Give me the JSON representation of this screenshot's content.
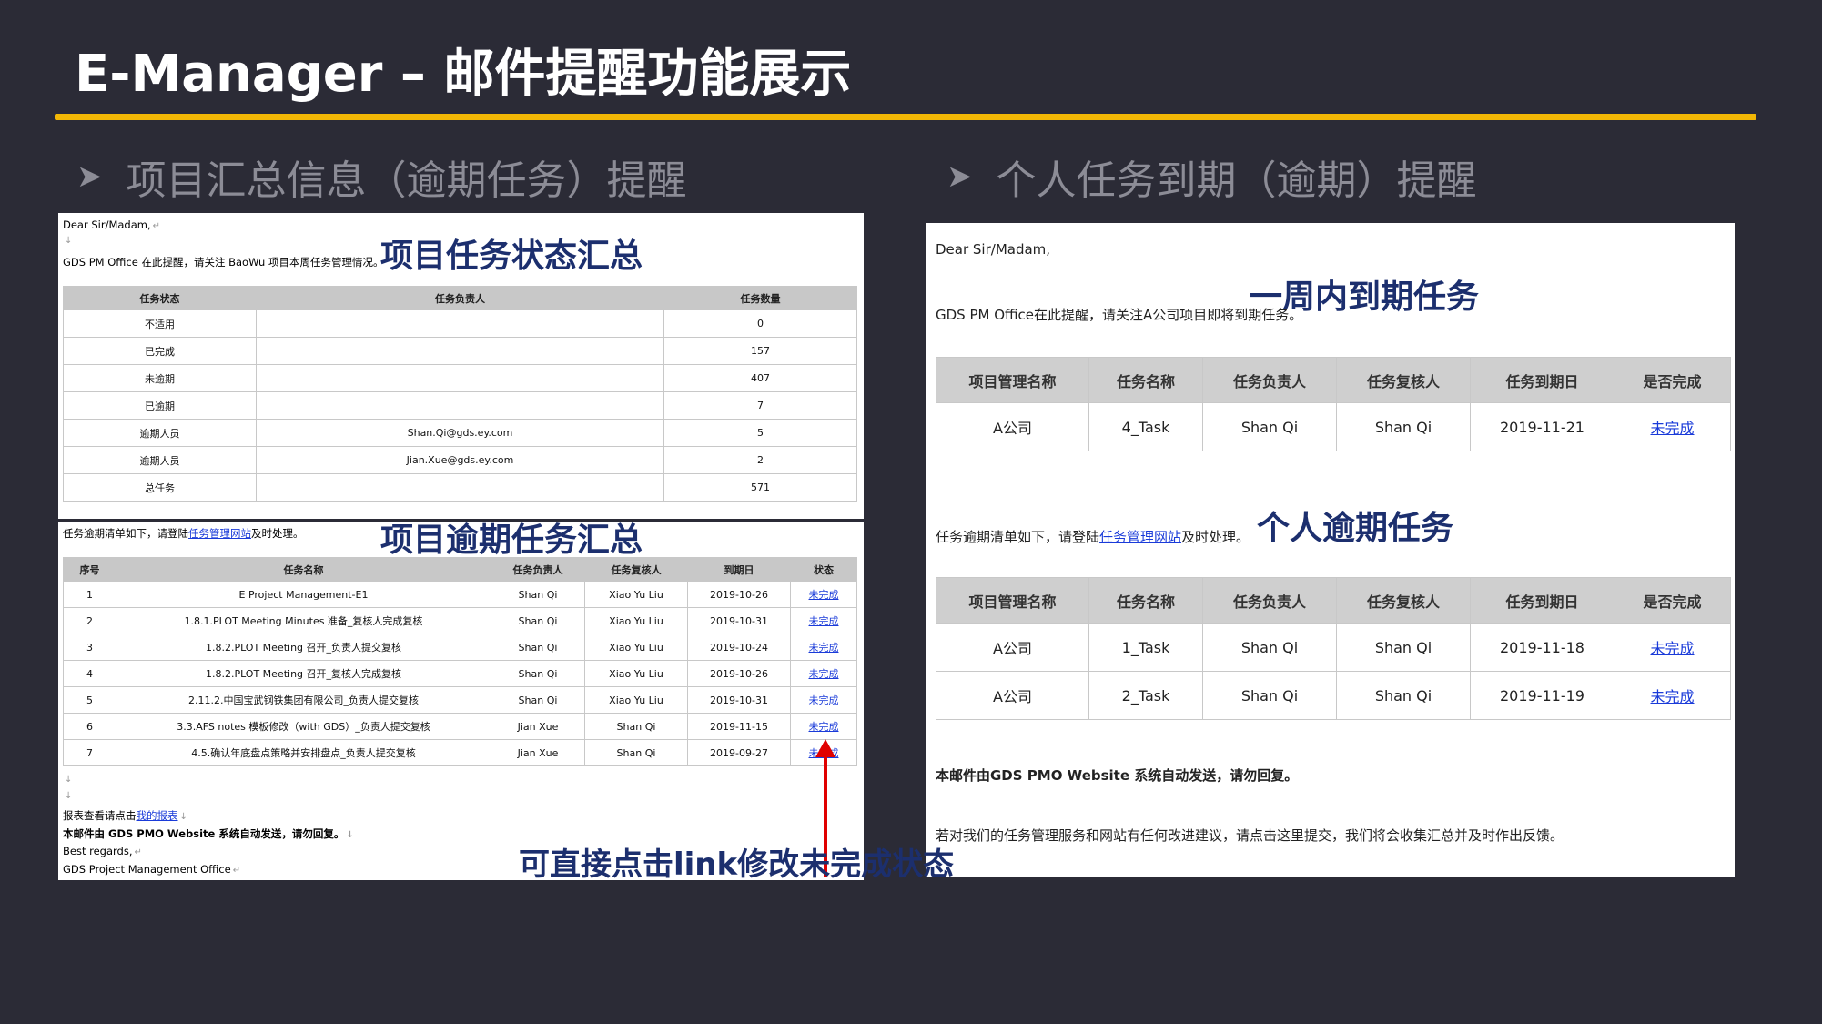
{
  "title": "E-Manager – 邮件提醒功能展示",
  "sections": {
    "left": "项目汇总信息（逾期任务）提醒",
    "right": "个人任务到期（逾期）提醒"
  },
  "icons": {
    "section_bullet": "arrowhead-bullet-icon"
  },
  "colors": {
    "background": "#2b2b36",
    "accent_rule": "#f2b705",
    "overlay_text": "#1c2f6e",
    "link": "#1a3bd9",
    "arrow": "#e00000"
  },
  "summary_mail": {
    "greeting": "Dear Sir/Madam,",
    "intro": "GDS PM Office 在此提醒，请关注 BaoWu 项目本周任务管理情况。",
    "overlay": "项目任务状态汇总",
    "headers": [
      "任务状态",
      "任务负责人",
      "任务数量"
    ],
    "rows": [
      [
        "不适用",
        "",
        "0"
      ],
      [
        "已完成",
        "",
        "157"
      ],
      [
        "未逾期",
        "",
        "407"
      ],
      [
        "已逾期",
        "",
        "7"
      ],
      [
        "逾期人员",
        "Shan.Qi@gds.ey.com",
        "5"
      ],
      [
        "逾期人员",
        "Jian.Xue@gds.ey.com",
        "2"
      ],
      [
        "总任务",
        "",
        "571"
      ]
    ]
  },
  "overdue_mail": {
    "intro_prefix": "任务逾期清单如下，请登陆",
    "intro_link": "任务管理网站",
    "intro_suffix": "及时处理。",
    "overlay": "项目逾期任务汇总",
    "headers": [
      "序号",
      "任务名称",
      "任务负责人",
      "任务复核人",
      "到期日",
      "状态"
    ],
    "rows": [
      [
        "1",
        "E Project Management-E1",
        "Shan Qi",
        "Xiao Yu Liu",
        "2019-10-26",
        "未完成"
      ],
      [
        "2",
        "1.8.1.PLOT Meeting Minutes 准备_复核人完成复核",
        "Shan Qi",
        "Xiao Yu Liu",
        "2019-10-31",
        "未完成"
      ],
      [
        "3",
        "1.8.2.PLOT Meeting 召开_负责人提交复核",
        "Shan Qi",
        "Xiao Yu Liu",
        "2019-10-24",
        "未完成"
      ],
      [
        "4",
        "1.8.2.PLOT Meeting 召开_复核人完成复核",
        "Shan Qi",
        "Xiao Yu Liu",
        "2019-10-26",
        "未完成"
      ],
      [
        "5",
        "2.11.2.中国宝武钢铁集团有限公司_负责人提交复核",
        "Shan Qi",
        "Xiao Yu Liu",
        "2019-10-31",
        "未完成"
      ],
      [
        "6",
        "3.3.AFS notes 模板修改（with GDS）_负责人提交复核",
        "Jian Xue",
        "Shan Qi",
        "2019-11-15",
        "未完成"
      ],
      [
        "7",
        "4.5.确认年底盘点策略并安排盘点_负责人提交复核",
        "Jian Xue",
        "Shan Qi",
        "2019-09-27",
        "未完成"
      ]
    ],
    "report_prefix": "报表查看请点击",
    "report_link": "我的报表",
    "auto_note": "本邮件由 GDS PMO Website 系统自动发送，请勿回复。",
    "regards": "Best regards,",
    "signature": "GDS Project Management Office"
  },
  "personal_mail": {
    "greeting": "Dear Sir/Madam,",
    "intro": "GDS PM Office在此提醒，请关注A公司项目即将到期任务。",
    "overlay_due": "一周内到期任务",
    "headers": [
      "项目管理名称",
      "任务名称",
      "任务负责人",
      "任务复核人",
      "任务到期日",
      "是否完成"
    ],
    "due_rows": [
      [
        "A公司",
        "4_Task",
        "Shan Qi",
        "Shan Qi",
        "2019-11-21",
        "未完成"
      ]
    ],
    "overdue_prefix": "任务逾期清单如下，请登陆",
    "overdue_link": "任务管理网站",
    "overdue_suffix": "及时处理。",
    "overlay_overdue": "个人逾期任务",
    "overdue_rows": [
      [
        "A公司",
        "1_Task",
        "Shan Qi",
        "Shan Qi",
        "2019-11-18",
        "未完成"
      ],
      [
        "A公司",
        "2_Task",
        "Shan Qi",
        "Shan Qi",
        "2019-11-19",
        "未完成"
      ]
    ],
    "auto_note": "本邮件由GDS PMO Website 系统自动发送，请勿回复。",
    "feedback": "若对我们的任务管理服务和网站有任何改进建议，请点击这里提交，我们将会收集汇总并及时作出反馈。"
  },
  "callout": "可直接点击link修改未完成状态"
}
